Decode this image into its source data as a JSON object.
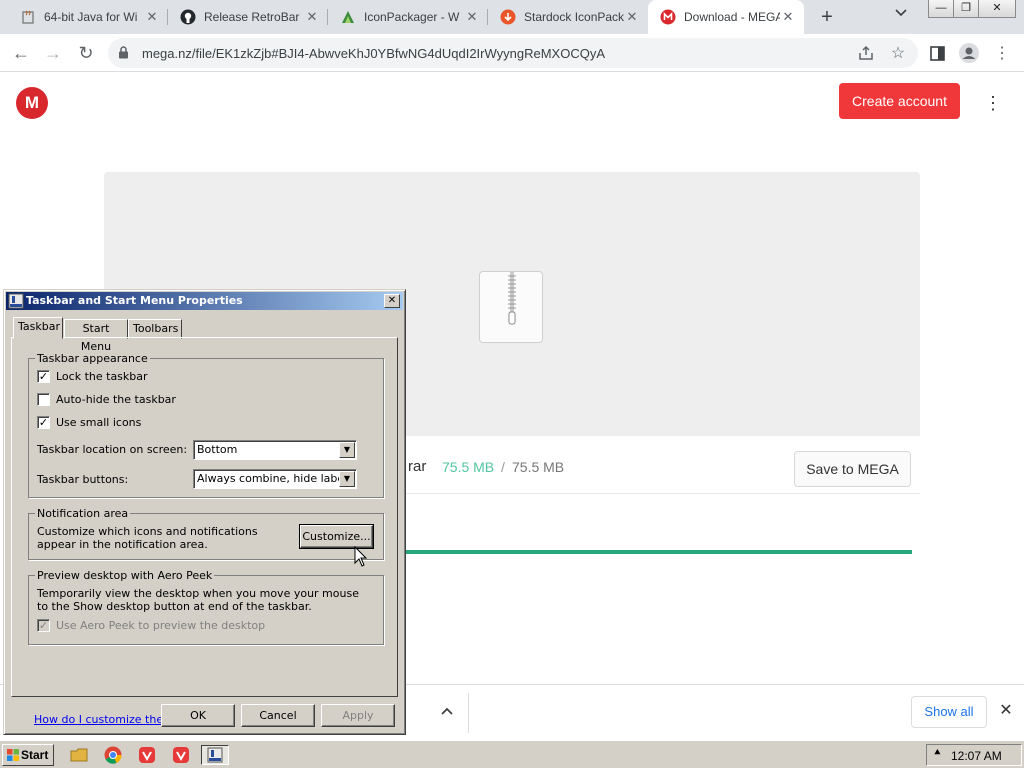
{
  "browser": {
    "tabs": [
      {
        "title": "64-bit Java for Wi",
        "icon": "java-icon"
      },
      {
        "title": "Release RetroBar",
        "icon": "github-icon"
      },
      {
        "title": "IconPackager - W",
        "icon": "iconpackager-icon"
      },
      {
        "title": "Stardock IconPack",
        "icon": "stardock-icon"
      },
      {
        "title": "Download - MEGA",
        "icon": "mega-icon",
        "active": true
      }
    ],
    "address": "mega.nz/file/EK1zkZjb#BJI4-AbwveKhJ0YBfwNG4dUqdI2IrWyyngReMXOCQyA",
    "window_buttons": [
      "—",
      "❐",
      "✕"
    ]
  },
  "mega": {
    "logo_letter": "M",
    "create_account": "Create account",
    "file_ext": "rar",
    "size_downloaded": "75.5 MB",
    "size_separator": "/",
    "size_total": "75.5 MB",
    "save_button": "Save to MEGA",
    "progress": 1.0,
    "accent": "#f0373a",
    "progress_color": "#2ba87b"
  },
  "download_shelf": {
    "show_all": "Show all"
  },
  "dialog": {
    "title": "Taskbar and Start Menu Properties",
    "tabs": [
      "Taskbar",
      "Start Menu",
      "Toolbars"
    ],
    "appearance_group": "Taskbar appearance",
    "lock_taskbar": {
      "label": "Lock the taskbar",
      "checked": true
    },
    "auto_hide": {
      "label": "Auto-hide the taskbar",
      "checked": false
    },
    "small_icons": {
      "label": "Use small icons",
      "checked": true
    },
    "location_label": "Taskbar location on screen:",
    "location_value": "Bottom",
    "buttons_label": "Taskbar buttons:",
    "buttons_value": "Always combine, hide labels",
    "notification_group": "Notification area",
    "notification_desc": "Customize which icons and notifications appear in the notification area.",
    "customize_button": "Customize...",
    "peek_group": "Preview desktop with Aero Peek",
    "peek_desc": "Temporarily view the desktop when you move your mouse to the Show desktop button at end of the taskbar.",
    "aero_peek": {
      "label": "Use Aero Peek to preview the desktop",
      "checked": true,
      "disabled": true
    },
    "help_link": "How do I customize the taskbar?",
    "ok": "OK",
    "cancel": "Cancel",
    "apply": "Apply"
  },
  "taskbar": {
    "start": "Start",
    "apps": [
      "explorer-icon",
      "chrome-icon",
      "vivaldi-icon",
      "vivaldi-icon",
      "taskbar-properties-icon"
    ],
    "clock": "12:07 AM",
    "tray_arrow": "⯅"
  }
}
